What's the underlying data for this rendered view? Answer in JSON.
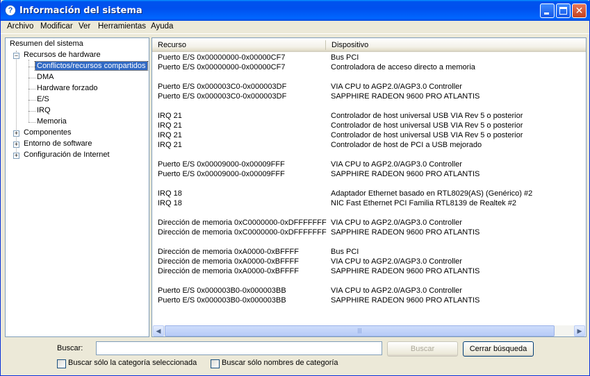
{
  "window": {
    "title": "Información del sistema"
  },
  "menu": [
    "Archivo",
    "Modificar",
    "Ver",
    "Herramientas",
    "Ayuda"
  ],
  "tree": {
    "root": "Resumen del sistema",
    "hardware": "Recursos de hardware",
    "hardware_children": [
      "Conflictos/recursos compartidos",
      "DMA",
      "Hardware forzado",
      "E/S",
      "IRQ",
      "Memoria"
    ],
    "components": "Componentes",
    "software": "Entorno de software",
    "internet": "Configuración de Internet",
    "expander_open": "−",
    "expander_closed": "+"
  },
  "list": {
    "columns": [
      "Recurso",
      "Dispositivo"
    ],
    "rows": [
      {
        "res": "Puerto E/S 0x00000000-0x00000CF7",
        "dev": "Bus PCI"
      },
      {
        "res": "Puerto E/S 0x00000000-0x00000CF7",
        "dev": "Controladora de acceso directo a memoria"
      },
      {
        "res": "Puerto E/S 0x000003C0-0x000003DF",
        "dev": "VIA CPU to AGP2.0/AGP3.0 Controller"
      },
      {
        "res": "Puerto E/S 0x000003C0-0x000003DF",
        "dev": "SAPPHIRE RADEON 9600 PRO ATLANTIS"
      },
      {
        "res": "IRQ 21",
        "dev": "Controlador de host universal USB VIA Rev 5 o posterior"
      },
      {
        "res": "IRQ 21",
        "dev": "Controlador de host universal USB VIA Rev 5 o posterior"
      },
      {
        "res": "IRQ 21",
        "dev": "Controlador de host universal USB VIA Rev 5 o posterior"
      },
      {
        "res": "IRQ 21",
        "dev": "Controlador de host de PCI a USB mejorado"
      },
      {
        "res": "Puerto E/S 0x00009000-0x00009FFF",
        "dev": "VIA CPU to AGP2.0/AGP3.0 Controller"
      },
      {
        "res": "Puerto E/S 0x00009000-0x00009FFF",
        "dev": "SAPPHIRE RADEON 9600 PRO ATLANTIS"
      },
      {
        "res": "IRQ 18",
        "dev": "Adaptador Ethernet basado en RTL8029(AS) (Genérico) #2"
      },
      {
        "res": "IRQ 18",
        "dev": "NIC Fast Ethernet PCI Familia RTL8139 de Realtek  #2"
      },
      {
        "res": "Dirección de memoria 0xC0000000-0xDFFFFFFF",
        "dev": "VIA CPU to AGP2.0/AGP3.0 Controller"
      },
      {
        "res": "Dirección de memoria 0xC0000000-0xDFFFFFFF",
        "dev": "SAPPHIRE RADEON 9600 PRO ATLANTIS"
      },
      {
        "res": "Dirección de memoria 0xA0000-0xBFFFF",
        "dev": "Bus PCI"
      },
      {
        "res": "Dirección de memoria 0xA0000-0xBFFFF",
        "dev": "VIA CPU to AGP2.0/AGP3.0 Controller"
      },
      {
        "res": "Dirección de memoria 0xA0000-0xBFFFF",
        "dev": "SAPPHIRE RADEON 9600 PRO ATLANTIS"
      },
      {
        "res": "Puerto E/S 0x000003B0-0x000003BB",
        "dev": "VIA CPU to AGP2.0/AGP3.0 Controller"
      },
      {
        "res": "Puerto E/S 0x000003B0-0x000003BB",
        "dev": "SAPPHIRE RADEON 9600 PRO ATLANTIS"
      }
    ]
  },
  "search": {
    "label": "Buscar:",
    "value": "",
    "find_button": "Buscar",
    "close_button": "Cerrar búsqueda",
    "check_selected_category": "Buscar sólo la categoría seleccionada",
    "check_category_names": "Buscar sólo nombres de categoría"
  },
  "icons": {
    "app": "info-icon",
    "minimize": "minimize-icon",
    "maximize": "maximize-icon",
    "close": "close-icon",
    "scroll_left": "arrow-left-icon",
    "scroll_right": "arrow-right-icon"
  }
}
